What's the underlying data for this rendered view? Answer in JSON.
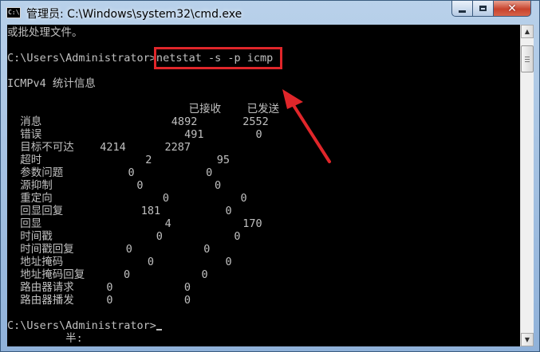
{
  "window": {
    "title": "管理员: C:\\Windows\\system32\\cmd.exe",
    "app_icon_text": "C:\\",
    "controls": {
      "minimize": "minimize",
      "maximize": "maximize",
      "close": "✕"
    }
  },
  "console": {
    "lines": [
      "或批处理文件。",
      "",
      "C:\\Users\\Administrator>netstat -s -p icmp",
      "",
      "ICMPv4 统计信息",
      "",
      "                            已接收    已发送",
      "  消息                    4892       2552",
      "  错误                      491        0",
      "  目标不可达    4214      2287",
      "  超时                2          95",
      "  参数问题          0           0",
      "  源抑制             0           0",
      "  重定向                 0           0",
      "  回显回复            181          0",
      "  回显                   4           170",
      "  时间戳                0           0",
      "  时间戳回复        0           0",
      "  地址掩码             0           0",
      "  地址掩码回复      0           0",
      "  路由器请求     0           0",
      "  路由器播发     0           0",
      "",
      "C:\\Users\\Administrator>",
      "         半:"
    ]
  },
  "scrollbar": {
    "up": "▲",
    "down": "▼"
  },
  "annotation": {
    "color": "#e0262a"
  }
}
